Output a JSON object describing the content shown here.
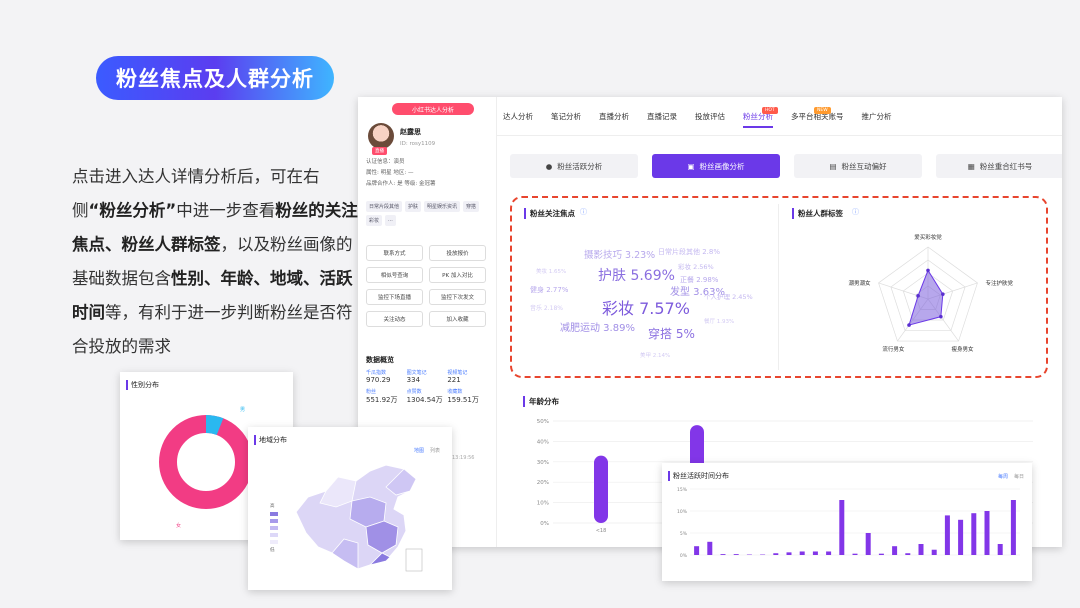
{
  "slide": {
    "title": "粉丝焦点及人群分析",
    "desc_parts": [
      {
        "t": "点击进入达人详情分析后，可在右侧",
        "b": false
      },
      {
        "t": "“粉丝分析”",
        "b": true
      },
      {
        "t": "中进一步查看",
        "b": false
      },
      {
        "t": "粉丝的关注焦点、粉丝人群标签",
        "b": true
      },
      {
        "t": "，以及粉丝画像的基础数据包含",
        "b": false
      },
      {
        "t": "性别、年龄、地域、活跃时间",
        "b": true
      },
      {
        "t": "等，有利于进一步判断粉丝是否符合投放的需求",
        "b": false
      }
    ]
  },
  "profile": {
    "banner": "小红书达人分析",
    "name": "赵露思",
    "id": "ID: rosy1109",
    "badge": "直播",
    "info": [
      "认证信息：演员",
      "属性: 明星    地区: —",
      "品牌合作人: 是    等级: 金冠薯"
    ],
    "tags": [
      "日常片段其他",
      "护肤",
      "明星娱乐资讯",
      "穿搭",
      "彩妆",
      "..."
    ],
    "buttons": [
      "联系方式",
      "投放报价",
      "相似号查询",
      "PK  加入对比",
      "监控下场直播",
      "监控下次发文",
      "关注动态",
      "加入收藏"
    ],
    "stats_title": "数据概览",
    "stats": [
      {
        "label": "千瓜指数",
        "value": "970.29"
      },
      {
        "label": "图文笔记",
        "value": "334"
      },
      {
        "label": "视频笔记",
        "value": "221"
      },
      {
        "label": "粉丝",
        "value": "551.92万"
      },
      {
        "label": "点赞数",
        "value": "1304.54万"
      },
      {
        "label": "收藏数",
        "value": "159.51万"
      }
    ],
    "time": "13:19:56"
  },
  "tabs": [
    "达人分析",
    "笔记分析",
    "直播分析",
    "直播记录",
    "投放评估",
    "粉丝分析",
    "多平台相关账号",
    "推广分析"
  ],
  "tab_badges": {
    "hot": "HOT",
    "new": "NEW"
  },
  "subtabs": [
    "粉丝活跃分析",
    "粉丝画像分析",
    "粉丝互动偏好",
    "粉丝重合红书号"
  ],
  "focus": {
    "title": "粉丝关注焦点",
    "words": [
      {
        "text": "摄影技巧 3.23%",
        "size": 9.5,
        "color": "#b7a8ec"
      },
      {
        "text": "日常片段其他 2.8%",
        "size": 7,
        "color": "#c4b8f0"
      },
      {
        "text": "美妆 1.65%",
        "size": 5.5,
        "color": "#d3cbf3"
      },
      {
        "text": "护肤 5.69%",
        "size": 14,
        "color": "#8b6fe0"
      },
      {
        "text": "彩妆 2.56%",
        "size": 6.5,
        "color": "#c4b8f0"
      },
      {
        "text": "正餐 2.98%",
        "size": 7,
        "color": "#b7a8ec"
      },
      {
        "text": "健身 2.77%",
        "size": 7,
        "color": "#b7a8ec"
      },
      {
        "text": "发型 3.63%",
        "size": 10,
        "color": "#a18fe6"
      },
      {
        "text": "个人护理 2.45%",
        "size": 6.5,
        "color": "#c4b8f0"
      },
      {
        "text": "音乐 2.18%",
        "size": 6,
        "color": "#d3cbf3"
      },
      {
        "text": "彩妆 7.57%",
        "size": 16,
        "color": "#7d5bdc"
      },
      {
        "text": "餐厅 1.93%",
        "size": 5.5,
        "color": "#d3cbf3"
      },
      {
        "text": "减肥运动 3.89%",
        "size": 10,
        "color": "#a18fe6"
      },
      {
        "text": "穿搭 5%",
        "size": 12,
        "color": "#8b6fe0"
      },
      {
        "text": "美甲 2.14%",
        "size": 5.5,
        "color": "#d3cbf3"
      }
    ]
  },
  "crowd": {
    "title": "粉丝人群标签",
    "labels": [
      "爱买彩妆党",
      "专注护肤党",
      "瘦身男女",
      "流行男女",
      "潮男潮女"
    ],
    "values": [
      0.55,
      0.3,
      0.42,
      0.62,
      0.2
    ]
  },
  "age": {
    "title": "年龄分布",
    "yticks": [
      "50%",
      "40%",
      "30%",
      "20%",
      "10%",
      "0%"
    ],
    "xlabel_first": "<18",
    "values": [
      33,
      48
    ]
  },
  "gender": {
    "title": "性别分布",
    "male_label": "男",
    "female_label": "女",
    "male": 0.06,
    "female": 0.94,
    "colors": {
      "female": "#f23c84",
      "male": "#2ab8f0"
    }
  },
  "region": {
    "title": "地域分布",
    "links": [
      "地图",
      "列表"
    ],
    "legend": [
      "高",
      "低"
    ]
  },
  "active": {
    "title": "粉丝活跃时间分布",
    "links": [
      "每周",
      "每日"
    ],
    "yticks": [
      "15%",
      "10%",
      "5%",
      "0%"
    ],
    "values": [
      2,
      3,
      0.2,
      0.2,
      0.1,
      0.1,
      0.4,
      0.6,
      0.8,
      0.8,
      0.8,
      12.5,
      0.3,
      5,
      0.3,
      2,
      0.4,
      2.5,
      1.2,
      9,
      8,
      9.5,
      10,
      2.5,
      12.5
    ]
  },
  "colors": {
    "accent": "#6b39e8",
    "pink": "#ff4d6d",
    "dash": "#e8452e"
  }
}
